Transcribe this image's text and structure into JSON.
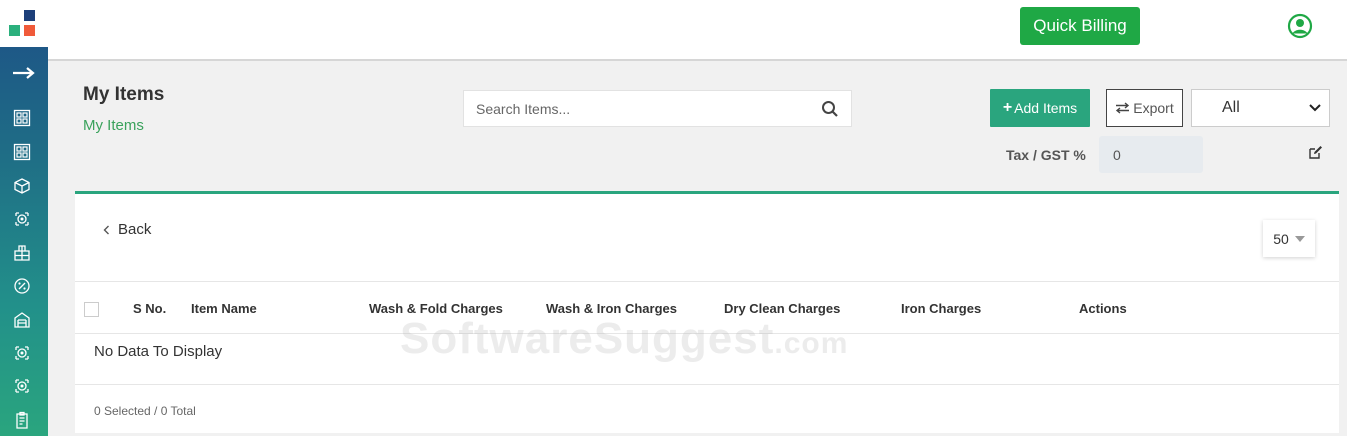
{
  "header": {
    "quick_billing_label": "Quick Billing"
  },
  "page": {
    "title": "My Items",
    "breadcrumb": "My Items"
  },
  "search": {
    "placeholder": "Search Items..."
  },
  "toolbar": {
    "add_items_label": "Add Items",
    "export_label": "Export",
    "filter_selected": "All",
    "tax_label": "Tax / GST %",
    "tax_value": "0"
  },
  "table": {
    "back_label": "Back",
    "page_size": "50",
    "columns": [
      "S No.",
      "Item Name",
      "Wash & Fold Charges",
      "Wash & Iron Charges",
      "Dry Clean Charges",
      "Iron Charges",
      "Actions"
    ],
    "empty_message": "No Data To Display",
    "footer_count": "0 Selected / 0 Total"
  },
  "watermark": {
    "text": "SoftwareSuggest",
    "suffix": ".com"
  },
  "colors": {
    "accent_green": "#2aa57e",
    "quick_billing_green": "#1fa845",
    "breadcrumb_green": "#3aa25c",
    "sidebar_top": "#1d4f87",
    "sidebar_bottom": "#2aa57e"
  },
  "icons": {
    "logo": "logo-squares",
    "sidebar_toggle": "arrow-right-icon",
    "sidebar": [
      "dashboard-icon",
      "grid-icon",
      "box-icon",
      "machine-icon",
      "building-icon",
      "percent-icon",
      "store-icon",
      "machine-icon",
      "machine-icon",
      "clipboard-icon"
    ],
    "user": "user-circle-icon",
    "search": "search-icon",
    "edit": "edit-icon"
  }
}
